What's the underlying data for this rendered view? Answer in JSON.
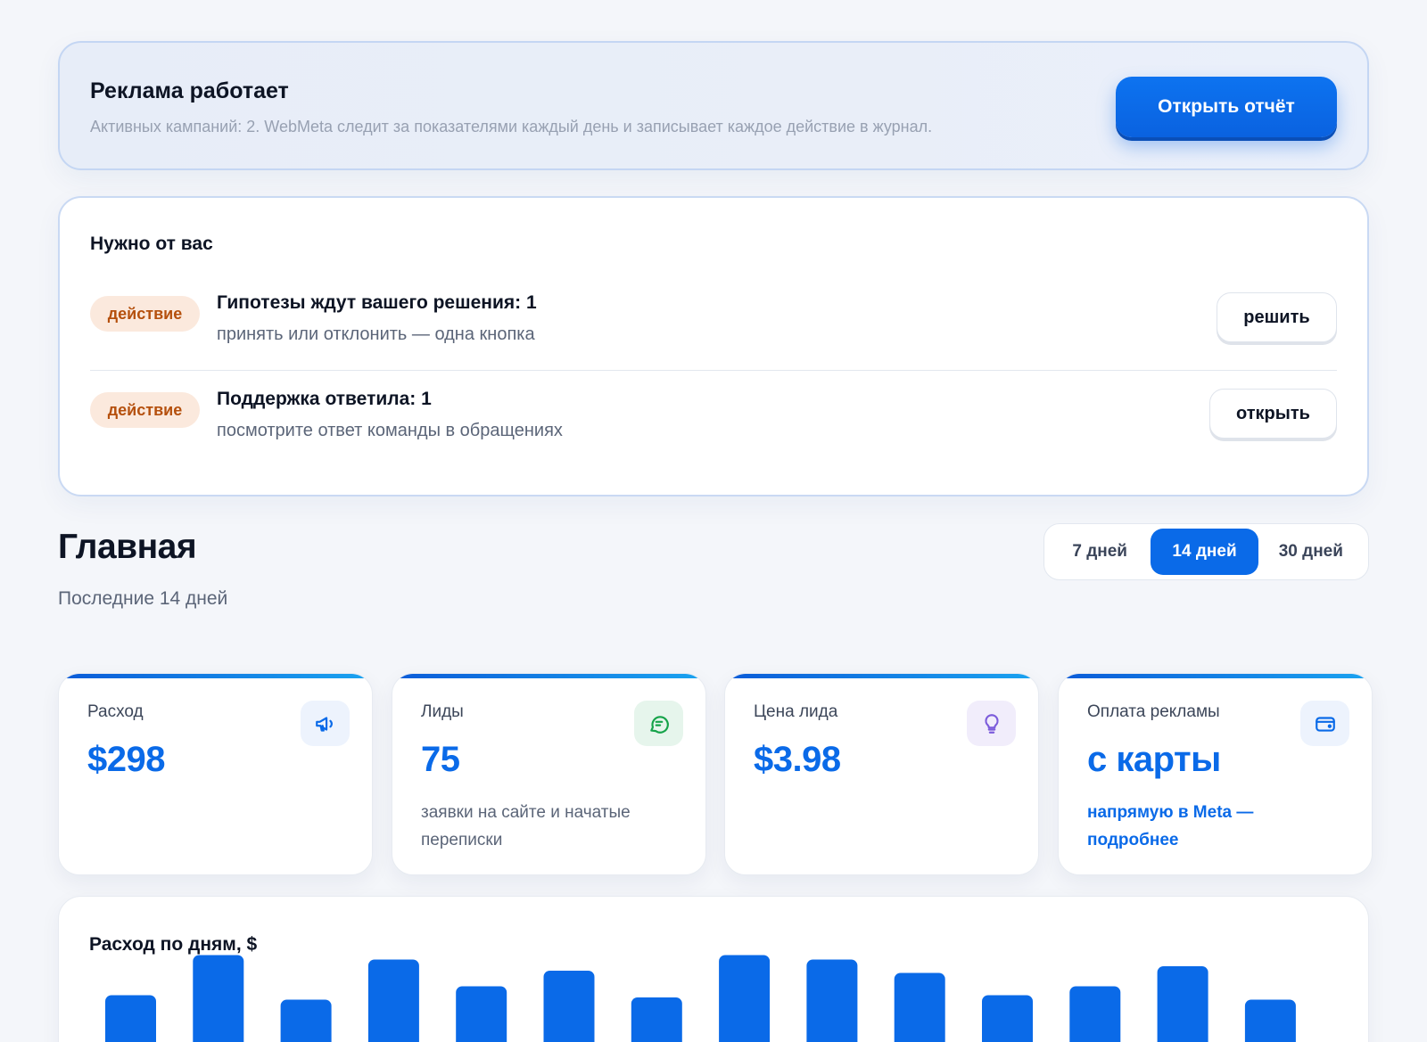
{
  "banner": {
    "title": "Реклама работает",
    "subtitle": "Активных кампаний: 2. WebMeta следит за показателями каждый день и записывает каждое действие в журнал.",
    "button_label": "Открыть отчёт"
  },
  "needs": {
    "title": "Нужно от вас",
    "items": [
      {
        "tag": "действие",
        "title": "Гипотезы ждут вашего решения: 1",
        "subtitle": "принять или отклонить — одна кнопка",
        "button": "решить"
      },
      {
        "tag": "действие",
        "title": "Поддержка ответила: 1",
        "subtitle": "посмотрите ответ команды в обращениях",
        "button": "открыть"
      }
    ]
  },
  "main": {
    "title": "Главная",
    "subtitle": "Последние 14 дней",
    "periods": [
      "7 дней",
      "14 дней",
      "30 дней"
    ],
    "selected_period": "14 дней"
  },
  "kpis": [
    {
      "label": "Расход",
      "value": "$298",
      "icon": "megaphone-icon"
    },
    {
      "label": "Лиды",
      "value": "75",
      "note": "заявки на сайте и начатые переписки",
      "icon": "chat-icon"
    },
    {
      "label": "Цена лида",
      "value": "$3.98",
      "icon": "lightbulb-icon"
    },
    {
      "label": "Оплата рекламы",
      "value": "с карты",
      "link": "напрямую в Meta — подробнее",
      "icon": "wallet-icon"
    }
  ],
  "colors": {
    "accent": "#0a6ae8",
    "tag_bg": "#fbe9dd",
    "tag_text": "#b5500d"
  },
  "chart_data": {
    "type": "bar",
    "title": "Расход по дням, $",
    "series_color": "#0a6ae8",
    "values": [
      17.5,
      26.5,
      16.5,
      25.5,
      19.5,
      23.0,
      17.0,
      26.5,
      25.5,
      22.5,
      17.5,
      19.5,
      24.0,
      16.5
    ],
    "ylim": [
      0,
      40
    ]
  }
}
